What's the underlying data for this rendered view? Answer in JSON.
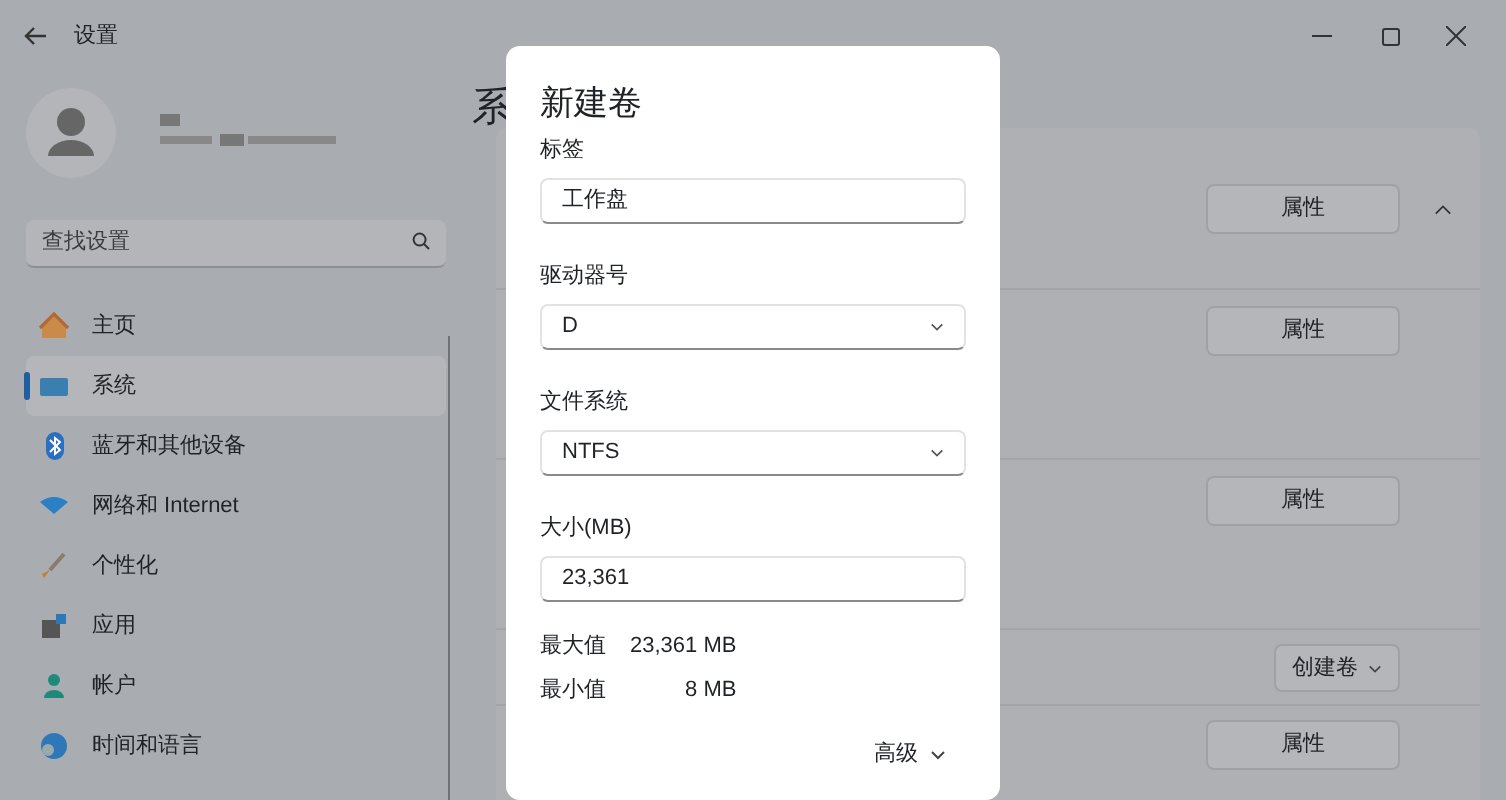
{
  "window": {
    "title": "设置"
  },
  "search": {
    "placeholder": "查找设置"
  },
  "nav": [
    {
      "label": "主页",
      "selected": false
    },
    {
      "label": "系统",
      "selected": true
    },
    {
      "label": "蓝牙和其他设备",
      "selected": false
    },
    {
      "label": "网络和 Internet",
      "selected": false
    },
    {
      "label": "个性化",
      "selected": false
    },
    {
      "label": "应用",
      "selected": false
    },
    {
      "label": "帐户",
      "selected": false
    },
    {
      "label": "时间和语言",
      "selected": false
    }
  ],
  "page": {
    "heading": "系",
    "rows": [
      {
        "kind": "properties",
        "button": "属性",
        "expanded": true
      },
      {
        "kind": "properties",
        "button": "属性"
      },
      {
        "kind": "properties",
        "button": "属性"
      },
      {
        "kind": "dropdown",
        "button": "创建卷"
      },
      {
        "kind": "properties",
        "button": "属性"
      }
    ]
  },
  "dialog": {
    "title": "新建卷",
    "fields": [
      {
        "label": "标签",
        "kind": "text",
        "value": "工作盘"
      },
      {
        "label": "驱动器号",
        "kind": "dropdown",
        "value": "D"
      },
      {
        "label": "文件系统",
        "kind": "dropdown",
        "value": "NTFS"
      },
      {
        "label": "大小(MB)",
        "kind": "text",
        "value": "23,361"
      }
    ],
    "limits": [
      {
        "label": "最大值",
        "value": "23,361 MB"
      },
      {
        "label": "最小值",
        "value": "8 MB"
      }
    ],
    "advanced": {
      "label": "高级",
      "expanded": false
    }
  }
}
